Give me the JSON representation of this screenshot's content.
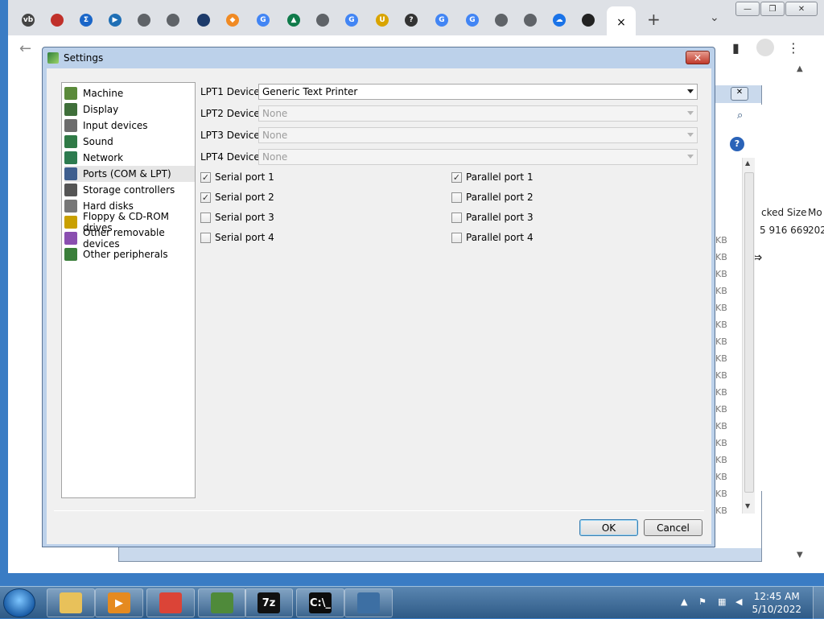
{
  "browser": {
    "new_tab_label": "+",
    "close_tab_label": "×",
    "dropdown_label": "⌄",
    "tabs": [
      {
        "icon": "vb-icon",
        "text": "vb",
        "color": "#444444"
      },
      {
        "icon": "red-square-icon",
        "text": "",
        "color": "#c0302a"
      },
      {
        "icon": "sigma-icon",
        "text": "Σ",
        "color": "#1a66c8"
      },
      {
        "icon": "play-icon",
        "text": "▶",
        "color": "#1f6fb5"
      },
      {
        "icon": "globe-icon",
        "text": "",
        "color": "#5f6368"
      },
      {
        "icon": "globe-icon",
        "text": "",
        "color": "#5f6368"
      },
      {
        "icon": "rocket-icon",
        "text": "",
        "color": "#1d3b6b"
      },
      {
        "icon": "diamond-icon",
        "text": "◆",
        "color": "#f08a24"
      },
      {
        "icon": "google-icon",
        "text": "G",
        "color": "#4285f4"
      },
      {
        "icon": "triangle-icon",
        "text": "▲",
        "color": "#0f7a4a"
      },
      {
        "icon": "globe-icon",
        "text": "",
        "color": "#5f6368"
      },
      {
        "icon": "google-icon",
        "text": "G",
        "color": "#4285f4"
      },
      {
        "icon": "ubio-icon",
        "text": "U",
        "color": "#d9a400"
      },
      {
        "icon": "question-icon",
        "text": "?",
        "color": "#333333"
      },
      {
        "icon": "google-icon",
        "text": "G",
        "color": "#4285f4"
      },
      {
        "icon": "google-icon",
        "text": "G",
        "color": "#4285f4"
      },
      {
        "icon": "globe-icon",
        "text": "",
        "color": "#5f6368"
      },
      {
        "icon": "globe-icon",
        "text": "",
        "color": "#5f6368"
      },
      {
        "icon": "cloud-icon",
        "text": "☁",
        "color": "#1a73e8"
      },
      {
        "icon": "github-icon",
        "text": "",
        "color": "#222222"
      }
    ]
  },
  "background_window": {
    "column_packed_size": "cked Size",
    "column_modified": "Mo",
    "row_value": "5 916 669",
    "row_date": "202",
    "kb_label": "KB"
  },
  "dialog": {
    "title": "Settings",
    "close_label": "✕",
    "nav": [
      {
        "label": "Machine",
        "icon": "machine-icon",
        "color": "#5a8a3a"
      },
      {
        "label": "Display",
        "icon": "display-icon",
        "color": "#3f6f3a"
      },
      {
        "label": "Input devices",
        "icon": "input-devices-icon",
        "color": "#6c6c6c"
      },
      {
        "label": "Sound",
        "icon": "sound-icon",
        "color": "#2f7a46"
      },
      {
        "label": "Network",
        "icon": "network-icon",
        "color": "#2d7b4f"
      },
      {
        "label": "Ports (COM & LPT)",
        "icon": "ports-icon",
        "color": "#3f5f8f",
        "selected": true
      },
      {
        "label": "Storage controllers",
        "icon": "storage-icon",
        "color": "#555555"
      },
      {
        "label": "Hard disks",
        "icon": "hard-disk-icon",
        "color": "#777777"
      },
      {
        "label": "Floppy & CD-ROM drives",
        "icon": "floppy-cdrom-icon",
        "color": "#c9a000"
      },
      {
        "label": "Other removable devices",
        "icon": "removable-device-icon",
        "color": "#8a4fb0"
      },
      {
        "label": "Other peripherals",
        "icon": "peripherals-icon",
        "color": "#3a7f3a"
      }
    ],
    "lpt": [
      {
        "label": "LPT1 Device:",
        "value": "Generic Text Printer",
        "enabled": true
      },
      {
        "label": "LPT2 Device:",
        "value": "None",
        "enabled": false
      },
      {
        "label": "LPT3 Device:",
        "value": "None",
        "enabled": false
      },
      {
        "label": "LPT4 Device:",
        "value": "None",
        "enabled": false
      }
    ],
    "serial": [
      {
        "label": "Serial port 1",
        "checked": true
      },
      {
        "label": "Serial port 2",
        "checked": true
      },
      {
        "label": "Serial port 3",
        "checked": false
      },
      {
        "label": "Serial port 4",
        "checked": false
      }
    ],
    "parallel": [
      {
        "label": "Parallel port 1",
        "checked": true
      },
      {
        "label": "Parallel port 2",
        "checked": false
      },
      {
        "label": "Parallel port 3",
        "checked": false
      },
      {
        "label": "Parallel port 4",
        "checked": false
      }
    ],
    "ok_label": "OK",
    "cancel_label": "Cancel"
  },
  "taskbar": {
    "apps": [
      {
        "name": "explorer-icon",
        "text": "",
        "color": "#e8c15a"
      },
      {
        "name": "media-player-icon",
        "text": "▶",
        "color": "#e58a1f"
      },
      {
        "name": "chrome-icon",
        "text": "",
        "color": "#db4437"
      },
      {
        "name": "device-manager-icon",
        "text": "",
        "color": "#4f8a3a"
      },
      {
        "name": "7zip-icon",
        "text": "7z",
        "color": "#111111"
      },
      {
        "name": "cmd-icon",
        "text": "C:\\_",
        "color": "#0c0c0c"
      },
      {
        "name": "window-app-icon",
        "text": "",
        "color": "#3d6fa3"
      }
    ],
    "time": "12:45 AM",
    "date": "5/10/2022"
  }
}
